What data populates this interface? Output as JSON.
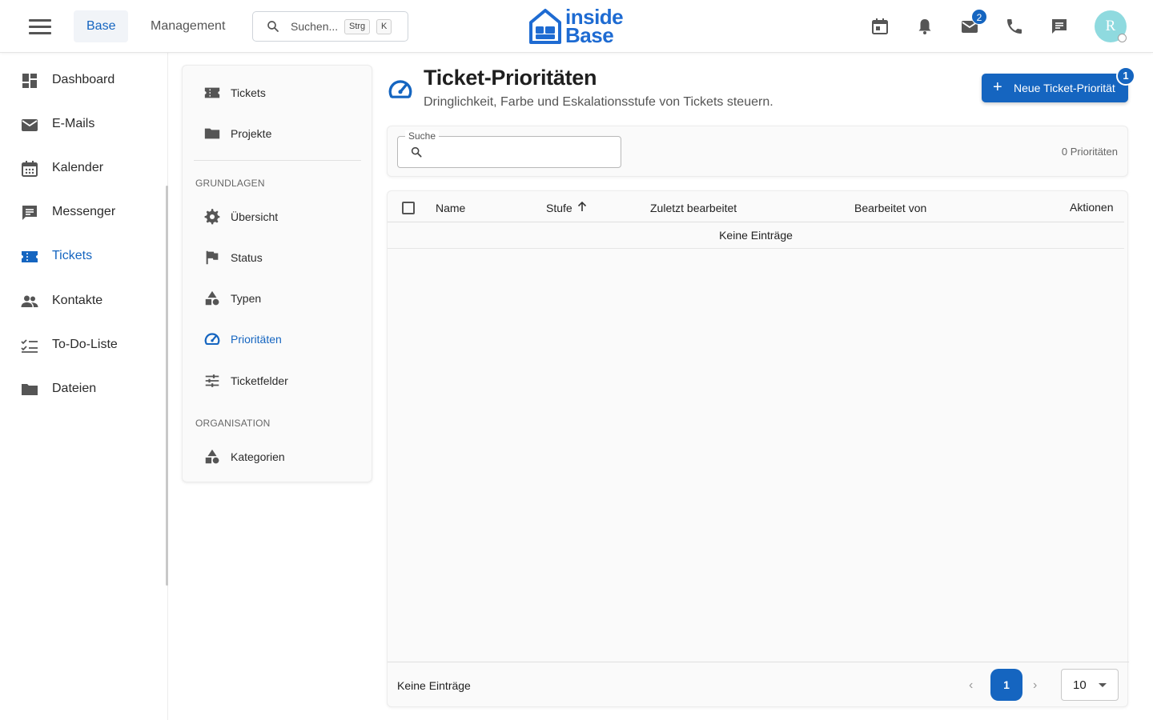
{
  "topbar": {
    "tabs": [
      {
        "label": "Base",
        "active": true
      },
      {
        "label": "Management",
        "active": false
      }
    ],
    "search": {
      "placeholder": "Suchen...",
      "shortcut_key1": "Strg",
      "shortcut_key2": "K"
    },
    "logo": {
      "line1": "inside",
      "line2": "Base"
    },
    "mail_badge": "2",
    "avatar_initial": "R",
    "icons": [
      "calendar-icon",
      "bell-icon",
      "mail-icon",
      "phone-icon",
      "chat-icon"
    ]
  },
  "sidebar": {
    "items": [
      {
        "label": "Dashboard",
        "icon": "dashboard-icon"
      },
      {
        "label": "E-Mails",
        "icon": "mail-icon"
      },
      {
        "label": "Kalender",
        "icon": "calendar-icon"
      },
      {
        "label": "Messenger",
        "icon": "message-icon"
      },
      {
        "label": "Tickets",
        "icon": "ticket-icon",
        "active": true
      },
      {
        "label": "Kontakte",
        "icon": "people-icon"
      },
      {
        "label": "To-Do-Liste",
        "icon": "checklist-icon"
      },
      {
        "label": "Dateien",
        "icon": "folder-icon"
      }
    ]
  },
  "subnav": {
    "top_items": [
      {
        "label": "Tickets",
        "icon": "ticket-icon"
      },
      {
        "label": "Projekte",
        "icon": "folder-icon"
      }
    ],
    "section1": "GRUNDLAGEN",
    "section1_items": [
      {
        "label": "Übersicht",
        "icon": "gear-icon"
      },
      {
        "label": "Status",
        "icon": "flag-icon"
      },
      {
        "label": "Typen",
        "icon": "shapes-icon"
      },
      {
        "label": "Prioritäten",
        "icon": "speedometer-icon",
        "active": true
      },
      {
        "label": "Ticketfelder",
        "icon": "sliders-icon"
      }
    ],
    "section2": "ORGANISATION",
    "section2_items": [
      {
        "label": "Kategorien",
        "icon": "shapes-icon"
      }
    ]
  },
  "main": {
    "title": "Ticket-Prioritäten",
    "subtitle": "Dringlichkeit, Farbe und Eskalationsstufe von Tickets steuern.",
    "new_button": "Neue Ticket-Priorität",
    "new_button_badge": "1",
    "search_label": "Suche",
    "count_text": "0 Prioritäten",
    "table": {
      "columns": [
        "Name",
        "Stufe",
        "Zuletzt bearbeitet",
        "Bearbeitet von",
        "Aktionen"
      ],
      "sort_column": "Stufe",
      "sort_direction": "ascending",
      "empty_text": "Keine Einträge",
      "rows": []
    },
    "footer": {
      "text": "Keine Einträge",
      "current_page": "1",
      "page_size": "10"
    }
  },
  "colors": {
    "accent": "#1565c0",
    "logo": "#1e6bd2",
    "avatar": "#8fdadf"
  }
}
